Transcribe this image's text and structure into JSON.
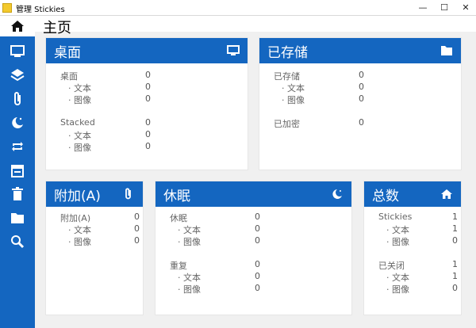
{
  "window": {
    "title": "管理 Stickies",
    "min": "—",
    "max": "☐",
    "close": "✕"
  },
  "page": {
    "title": "主页"
  },
  "colors": {
    "accent": "#1466c0"
  },
  "sidebar": {
    "items": [
      {
        "name": "home-icon"
      },
      {
        "name": "monitor-icon"
      },
      {
        "name": "layers-icon"
      },
      {
        "name": "paperclip-icon"
      },
      {
        "name": "moon-icon"
      },
      {
        "name": "repeat-icon"
      },
      {
        "name": "calendar-icon"
      },
      {
        "name": "trash-icon"
      },
      {
        "name": "folder-icon"
      },
      {
        "name": "search-icon"
      }
    ]
  },
  "cards": {
    "desktop": {
      "title": "桌面",
      "icon": "monitor-icon",
      "rows": [
        {
          "label": "桌面",
          "value": "0"
        },
        {
          "label": "· 文本",
          "value": "0"
        },
        {
          "label": "· 图像",
          "value": "0"
        },
        {
          "label": "Stacked",
          "value": "0"
        },
        {
          "label": "· 文本",
          "value": "0"
        },
        {
          "label": "· 图像",
          "value": "0"
        }
      ]
    },
    "stored": {
      "title": "已存储",
      "icon": "folder-icon",
      "rows": [
        {
          "label": "已存储",
          "value": "0"
        },
        {
          "label": "· 文本",
          "value": "0"
        },
        {
          "label": "· 图像",
          "value": "0"
        },
        {
          "label": "已加密",
          "value": "0"
        }
      ]
    },
    "attached": {
      "title": "附加(A)",
      "icon": "paperclip-icon",
      "rows": [
        {
          "label": "附加(A)",
          "value": "0"
        },
        {
          "label": "· 文本",
          "value": "0"
        },
        {
          "label": "· 图像",
          "value": "0"
        }
      ]
    },
    "sleep": {
      "title": "休眠",
      "icon": "moon-icon",
      "rows": [
        {
          "label": "休眠",
          "value": "0"
        },
        {
          "label": "· 文本",
          "value": "0"
        },
        {
          "label": "· 图像",
          "value": "0"
        },
        {
          "label": "重复",
          "value": "0"
        },
        {
          "label": "· 文本",
          "value": "0"
        },
        {
          "label": "· 图像",
          "value": "0"
        }
      ]
    },
    "total": {
      "title": "总数",
      "icon": "home-icon",
      "rows": [
        {
          "label": "Stickies",
          "value": "1"
        },
        {
          "label": "· 文本",
          "value": "1"
        },
        {
          "label": "· 图像",
          "value": "0"
        },
        {
          "label": "已关闭",
          "value": "1"
        },
        {
          "label": "· 文本",
          "value": "1"
        },
        {
          "label": "· 图像",
          "value": "0"
        }
      ]
    }
  }
}
